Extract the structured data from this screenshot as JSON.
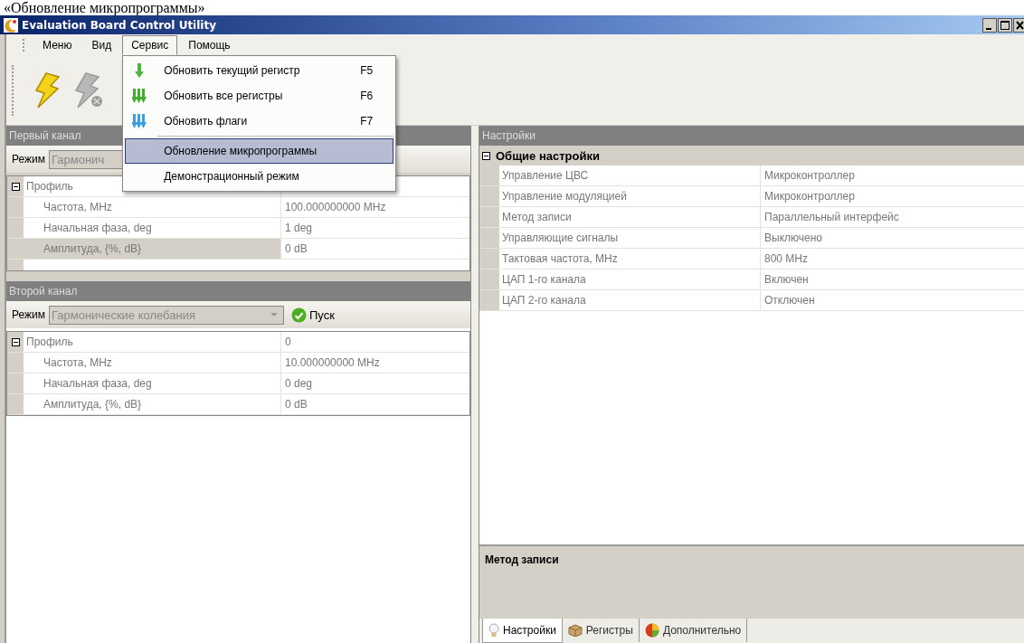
{
  "caption": "«Обновление микропрограммы»",
  "window": {
    "title": "Evaluation Board Control Utility"
  },
  "menubar": [
    {
      "label": "Меню",
      "selected": false
    },
    {
      "label": "Вид",
      "selected": false
    },
    {
      "label": "Сервис",
      "selected": true
    },
    {
      "label": "Помощь",
      "selected": false
    }
  ],
  "menu": {
    "items": [
      {
        "label": "Обновить текущий регистр",
        "shortcut": "F5",
        "selected": false,
        "separator_before": false
      },
      {
        "label": "Обновить все регистры",
        "shortcut": "F6",
        "selected": false,
        "separator_before": false
      },
      {
        "label": "Обновить флаги",
        "shortcut": "F7",
        "selected": false,
        "separator_before": false
      },
      {
        "label": "Обновление микропрограммы",
        "selected": true,
        "separator_before": true
      },
      {
        "label": "Демонстрационный режим",
        "selected": false,
        "separator_before": false
      }
    ]
  },
  "channels": [
    {
      "title": "Первый канал",
      "mode_label": "Режим",
      "mode_value": "Гармонич",
      "group": {
        "label": "Профиль",
        "expanded": true
      },
      "rows": [
        {
          "name": "Частота, MHz",
          "value": "100.000000000 MHz",
          "selected": false
        },
        {
          "name": "Начальная фаза, deg",
          "value": "1 deg",
          "selected": false
        },
        {
          "name": "Амплитуда, {%, dB}",
          "value": "0 dB",
          "selected": true
        }
      ]
    },
    {
      "title": "Второй канал",
      "mode_label": "Режим",
      "mode_value": "Гармонические колебания",
      "start_button": "Пуск",
      "group": {
        "label": "Профиль",
        "value": "0",
        "expanded": true
      },
      "rows": [
        {
          "name": "Частота, MHz",
          "value": "10.000000000 MHz",
          "selected": false
        },
        {
          "name": "Начальная фаза, deg",
          "value": "0 deg",
          "selected": false
        },
        {
          "name": "Амплитуда, {%, dB}",
          "value": "0 dB",
          "selected": false
        }
      ]
    }
  ],
  "settings": {
    "title": "Настройки",
    "category": {
      "label": "Общие настройки",
      "expanded": true
    },
    "rows": [
      {
        "name": "Управление ЦВС",
        "value": "Микроконтроллер"
      },
      {
        "name": "Управление модуляцией",
        "value": "Микроконтроллер"
      },
      {
        "name": "Метод записи",
        "value": "Параллельный интерфейс"
      },
      {
        "name": "Управляющие сигналы",
        "value": "Выключено"
      },
      {
        "name": "Тактовая частота, MHz",
        "value": "800 MHz"
      },
      {
        "name": "ЦАП 1-го канала",
        "value": "Включен"
      },
      {
        "name": "ЦАП 2-го канала",
        "value": "Отключен"
      }
    ],
    "description": "Метод записи"
  },
  "tabs": [
    {
      "label": "Настройки",
      "selected": true
    },
    {
      "label": "Регистры",
      "selected": false
    },
    {
      "label": "Дополнительно",
      "selected": false
    }
  ]
}
